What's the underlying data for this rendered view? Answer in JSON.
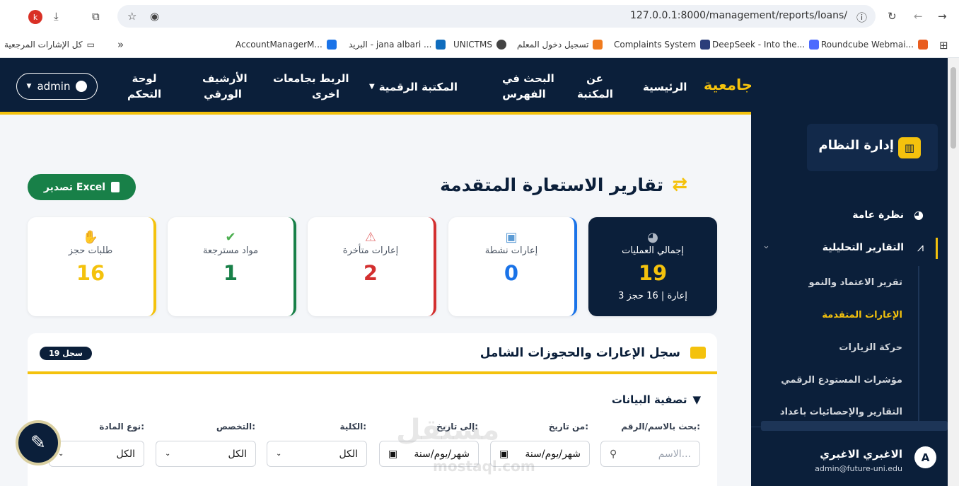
{
  "browser": {
    "profile_initial": "k",
    "url": "127.0.0.1:8000/management/reports/loans/",
    "bookmarks": [
      {
        "label": "Roundcube Webmai...",
        "color": "#e95d1f"
      },
      {
        "label": "DeepSeek - Into the...",
        "color": "#4d6bfe"
      },
      {
        "label": "Complaints System",
        "color": "#2c3e7a"
      },
      {
        "label": "تسجيل دخول المعلم",
        "color": "#f07b1d"
      },
      {
        "label": "UNICTMS",
        "color": "#444444"
      },
      {
        "label": "البريد - jana albari ...",
        "color": "#0f6cbd"
      },
      {
        "label": "AccountManagerM...",
        "color": "#1a73e8"
      }
    ],
    "all_bookmarks": "كل الإشارات المرجعية"
  },
  "navbar": {
    "brand": "جامعية",
    "items": {
      "home": "الرئيسية",
      "about_1": "عن",
      "about_2": "المكتبة",
      "search_1": "البحث في",
      "search_2": "الفهرس",
      "digital": "المكتبة الرقمية",
      "link_1": "الربط بجامعات",
      "link_2": "اخرى",
      "archive_1": "الأرشيف",
      "archive_2": "الورقي",
      "dash_1": "لوحة",
      "dash_2": "التحكم"
    },
    "user_label": "admin"
  },
  "main": {
    "title": "تقارير الاستعارة المتقدمة",
    "export_label": "تصدير Excel",
    "cards": [
      {
        "label": "إجمالي العمليات",
        "value": "19",
        "sub": "3 إعارة | 16 حجز",
        "color": "#f4c20d"
      },
      {
        "label": "إعارات نشطة",
        "value": "0",
        "color": "#1a73e8"
      },
      {
        "label": "إعارات متأخرة",
        "value": "2",
        "color": "#d32f2f"
      },
      {
        "label": "مواد مسترجعة",
        "value": "1",
        "color": "#188048"
      },
      {
        "label": "طلبات حجز",
        "value": "16",
        "color": "#f4c20d"
      }
    ],
    "panel": {
      "title": "سجل الإعارات والحجوزات الشامل",
      "count": "19 سجل",
      "filter_title": "تصفية البيانات",
      "filters": {
        "search_label": "بحث بالاسم/الرقم:",
        "search_placeholder": "الاسم...",
        "from_label": "من تاريخ:",
        "from_value": "شهر/يوم/سنة",
        "to_label": "إلى تاريخ:",
        "to_value": "شهر/يوم/سنة",
        "college_label": "الكلية:",
        "college_value": "الكل",
        "major_label": "التخصص:",
        "major_value": "الكل",
        "type_label": "نوع المادة:",
        "type_value": "الكل"
      }
    }
  },
  "sidebar": {
    "brand": "إدارة النظام",
    "items": {
      "overview": "نظرة عامة",
      "analytics": "التقارير التحليلية"
    },
    "subitems": [
      "تقرير الاعتماد والنمو",
      "الإعارات المتقدمة",
      "حركة الزيارات",
      "مؤشرات المستودع الرقمي",
      "التقارير والإحصائيات باعداد"
    ],
    "user": {
      "initial": "A",
      "name": "الاغبري الاغبري",
      "email": "admin@future-uni.edu"
    }
  },
  "watermark": {
    "ar": "مستقل",
    "en": "mostaql.com"
  }
}
